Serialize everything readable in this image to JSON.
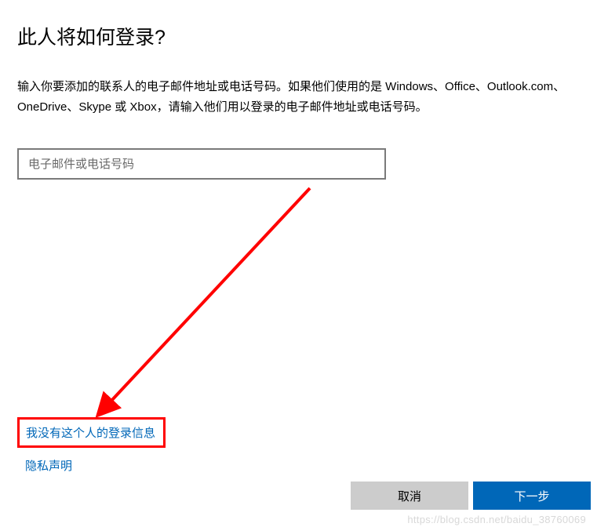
{
  "title": "此人将如何登录?",
  "description": "输入你要添加的联系人的电子邮件地址或电话号码。如果他们使用的是 Windows、Office、Outlook.com、OneDrive、Skype 或 Xbox，请输入他们用以登录的电子邮件地址或电话号码。",
  "input": {
    "placeholder": "电子邮件或电话号码"
  },
  "links": {
    "no_signin_info": "我没有这个人的登录信息",
    "privacy": "隐私声明"
  },
  "buttons": {
    "cancel": "取消",
    "next": "下一步"
  },
  "annotation": {
    "arrow_color": "#ff0000",
    "highlight_color": "#ff0000"
  },
  "watermark": "https://blog.csdn.net/baidu_38760069"
}
